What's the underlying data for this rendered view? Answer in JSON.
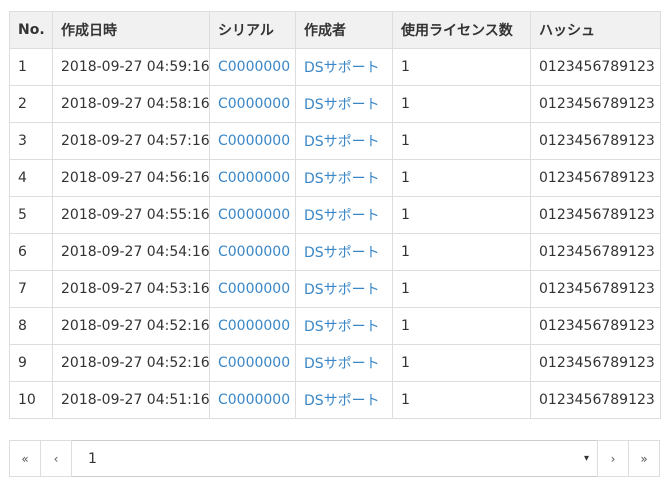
{
  "table": {
    "headers": [
      "No.",
      "作成日時",
      "シリアル",
      "作成者",
      "使用ライセンス数",
      "ハッシュ"
    ],
    "rows": [
      {
        "no": "1",
        "created": "2018-09-27 04:59:16",
        "serial": "C0000000",
        "author": "DSサポート",
        "licenses": "1",
        "hash": "0123456789123"
      },
      {
        "no": "2",
        "created": "2018-09-27 04:58:16",
        "serial": "C0000000",
        "author": "DSサポート",
        "licenses": "1",
        "hash": "0123456789123"
      },
      {
        "no": "3",
        "created": "2018-09-27 04:57:16",
        "serial": "C0000000",
        "author": "DSサポート",
        "licenses": "1",
        "hash": "0123456789123"
      },
      {
        "no": "4",
        "created": "2018-09-27 04:56:16",
        "serial": "C0000000",
        "author": "DSサポート",
        "licenses": "1",
        "hash": "0123456789123"
      },
      {
        "no": "5",
        "created": "2018-09-27 04:55:16",
        "serial": "C0000000",
        "author": "DSサポート",
        "licenses": "1",
        "hash": "0123456789123"
      },
      {
        "no": "6",
        "created": "2018-09-27 04:54:16",
        "serial": "C0000000",
        "author": "DSサポート",
        "licenses": "1",
        "hash": "0123456789123"
      },
      {
        "no": "7",
        "created": "2018-09-27 04:53:16",
        "serial": "C0000000",
        "author": "DSサポート",
        "licenses": "1",
        "hash": "0123456789123"
      },
      {
        "no": "8",
        "created": "2018-09-27 04:52:16",
        "serial": "C0000000",
        "author": "DSサポート",
        "licenses": "1",
        "hash": "0123456789123"
      },
      {
        "no": "9",
        "created": "2018-09-27 04:52:16",
        "serial": "C0000000",
        "author": "DSサポート",
        "licenses": "1",
        "hash": "0123456789123"
      },
      {
        "no": "10",
        "created": "2018-09-27 04:51:16",
        "serial": "C0000000",
        "author": "DSサポート",
        "licenses": "1",
        "hash": "0123456789123"
      }
    ]
  },
  "pagination": {
    "first_label": "«",
    "prev_label": "‹",
    "page_value": "1",
    "dropdown_icon": "▾",
    "next_label": "›",
    "last_label": "»"
  },
  "colors": {
    "link": "#3a87c7",
    "header_bg": "#f1f1f1",
    "border": "#dddddd"
  }
}
